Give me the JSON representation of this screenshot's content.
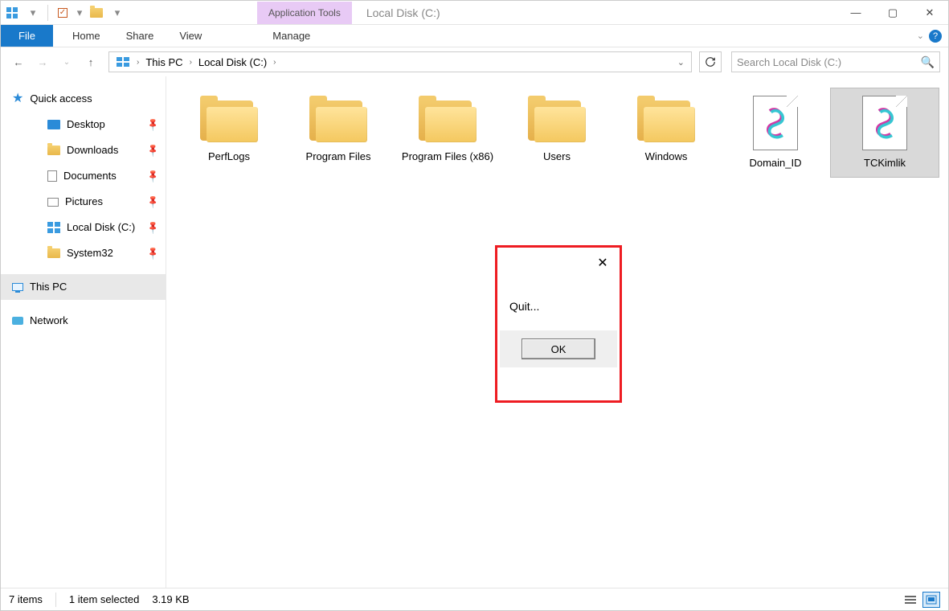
{
  "window": {
    "contextual_tab": "Application Tools",
    "title": "Local Disk (C:)"
  },
  "ribbon": {
    "file": "File",
    "tabs": [
      "Home",
      "Share",
      "View"
    ],
    "manage": "Manage"
  },
  "breadcrumb": {
    "root": "This PC",
    "current": "Local Disk (C:)"
  },
  "search": {
    "placeholder": "Search Local Disk (C:)"
  },
  "sidebar": {
    "quick_access": "Quick access",
    "pinned": [
      {
        "label": "Desktop",
        "icon": "desktop"
      },
      {
        "label": "Downloads",
        "icon": "folder"
      },
      {
        "label": "Documents",
        "icon": "document"
      },
      {
        "label": "Pictures",
        "icon": "picture"
      },
      {
        "label": "Local Disk (C:)",
        "icon": "drive"
      },
      {
        "label": "System32",
        "icon": "folder"
      }
    ],
    "this_pc": "This PC",
    "network": "Network"
  },
  "items": [
    {
      "name": "PerfLogs",
      "type": "folder"
    },
    {
      "name": "Program Files",
      "type": "folder"
    },
    {
      "name": "Program Files (x86)",
      "type": "folder"
    },
    {
      "name": "Users",
      "type": "folder"
    },
    {
      "name": "Windows",
      "type": "folder"
    },
    {
      "name": "Domain_ID",
      "type": "script"
    },
    {
      "name": "TCKimlik",
      "type": "script",
      "selected": true
    }
  ],
  "dialog": {
    "message": "Quit...",
    "ok": "OK"
  },
  "status": {
    "count": "7 items",
    "selection": "1 item selected",
    "size": "3.19 KB"
  }
}
